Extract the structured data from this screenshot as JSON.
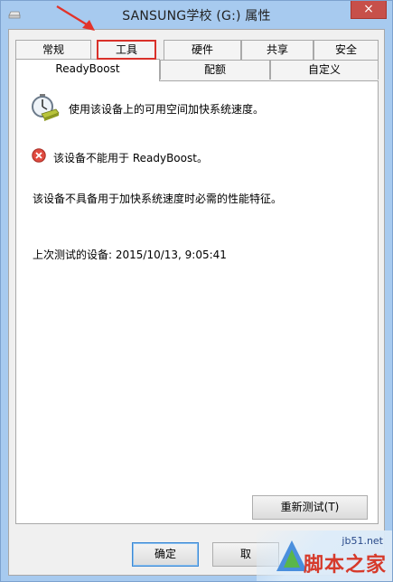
{
  "window": {
    "title": "SANSUNG学校 (G:) 属性",
    "close_label": "×"
  },
  "tabs_row1": [
    "常规",
    "工具",
    "硬件",
    "共享",
    "安全"
  ],
  "tabs_row2": [
    "ReadyBoost",
    "配额",
    "自定义"
  ],
  "active_tab": "ReadyBoost",
  "highlighted_tab": "工具",
  "panel": {
    "use_device_text": "使用该设备上的可用空间加快系统速度。",
    "cannot_use_text": "该设备不能用于 ReadyBoost。",
    "reason_text": "该设备不具备用于加快系统速度时必需的性能特征。",
    "last_test_text": "上次测试的设备: 2015/10/13, 9:05:41",
    "retest_button": "重新测试(T)"
  },
  "footer": {
    "ok_button": "确定",
    "cancel_button": "取"
  },
  "watermark": {
    "url": "jb51.net",
    "name": "脚本之家"
  },
  "colors": {
    "highlight_red": "#d9312a",
    "close_red": "#c7504a",
    "window_blue": "#a7caef"
  }
}
